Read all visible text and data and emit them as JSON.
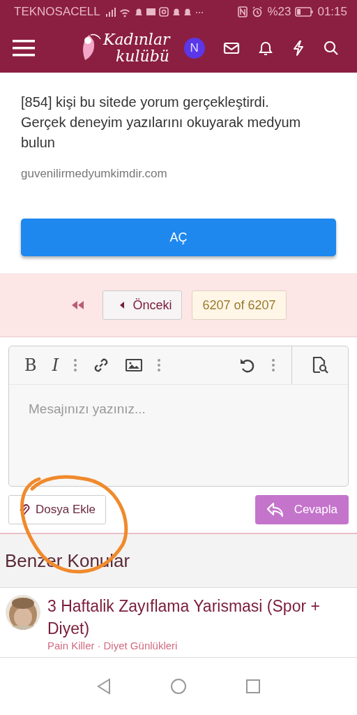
{
  "status_bar": {
    "carrier": "TEKNOSACELL",
    "battery": "%23",
    "time": "01:15"
  },
  "header": {
    "logo_line_1": "Kadınlar",
    "logo_line_2": "kulübü",
    "avatar_letter": "N"
  },
  "ad": {
    "text": "[854] kişi bu sitede yorum gerçekleştirdi. Gerçek deneyim yazılarını okuyarak medyum bulun",
    "domain": "guvenilirmedyumkimdir.com",
    "button": "AÇ"
  },
  "pagination": {
    "previous": "Önceki",
    "current": "6207 of 6207"
  },
  "editor": {
    "placeholder": "Mesajınızı yazınız...",
    "bold": "B",
    "italic": "I"
  },
  "actions": {
    "attach": "Dosya Ekle",
    "reply": "Cevapla"
  },
  "similar": {
    "title": "Benzer Konular",
    "threads": [
      {
        "title": "3 Haftalik Zayıflama Yarismasi (Spor + Diyet)",
        "author": "Pain Killer",
        "separator": "·",
        "forum": "Diyet Günlükleri"
      }
    ]
  }
}
